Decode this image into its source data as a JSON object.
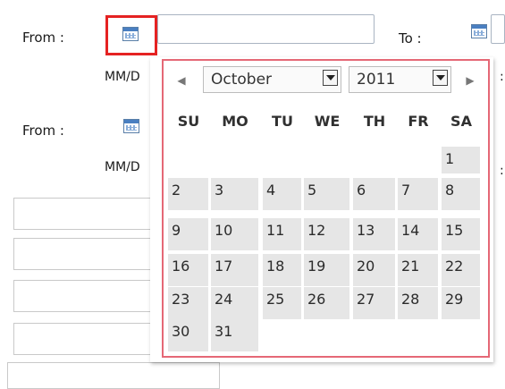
{
  "form": {
    "row1": {
      "from_label": "From :",
      "to_label": "To :",
      "hint": "MM/D"
    },
    "row2": {
      "from_label": "From :",
      "hint": "MM/D"
    },
    "edge_glyph": ":"
  },
  "datepicker": {
    "prev_arrow": "◀",
    "next_arrow": "▶",
    "month": "October",
    "year": "2011",
    "weekdays": [
      "SU",
      "MO",
      "TU",
      "WE",
      "TH",
      "FR",
      "SA"
    ],
    "weeks": [
      [
        "",
        "",
        "",
        "",
        "",
        "",
        "1"
      ],
      [
        "2",
        "3",
        "4",
        "5",
        "6",
        "7",
        "8"
      ],
      [
        "9",
        "10",
        "11",
        "12",
        "13",
        "14",
        "15"
      ],
      [
        "16",
        "17",
        "18",
        "19",
        "20",
        "21",
        "22"
      ],
      [
        "23",
        "24",
        "25",
        "26",
        "27",
        "28",
        "29"
      ],
      [
        "30",
        "31",
        "",
        "",
        "",
        "",
        ""
      ]
    ]
  },
  "colors": {
    "highlight": "#e52222",
    "popup_border": "#e56876",
    "day_cell": "#e6e6e6"
  }
}
